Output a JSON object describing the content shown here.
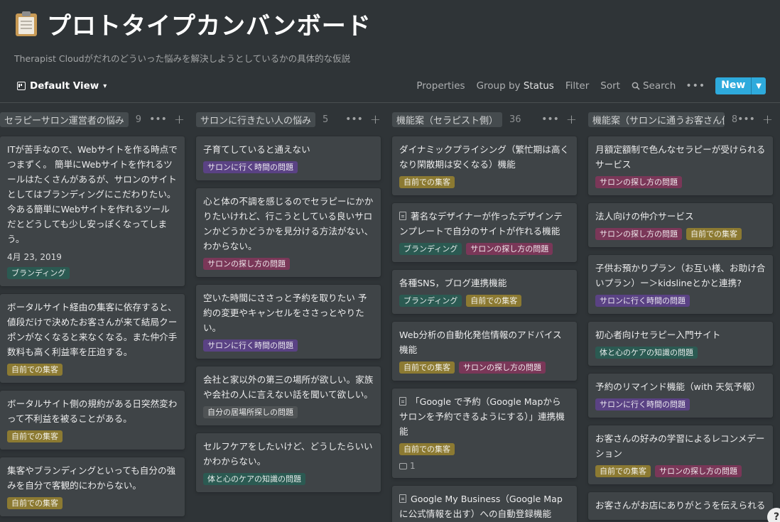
{
  "page": {
    "icon": "clipboard-icon",
    "title": "プロトタイプカンバンボード",
    "subtitle": "Therapist Cloudがだれのどういった悩みを解決しようとしているかの具体的な仮説"
  },
  "toolbar": {
    "view_label": "Default View",
    "properties": "Properties",
    "group_by_prefix": "Group by",
    "group_by_value": "Status",
    "filter": "Filter",
    "sort": "Sort",
    "search": "Search",
    "more": "•••",
    "new_label": "New"
  },
  "colors": {
    "accent": "#2eaadc",
    "tag_colors": {
      "green": "#2b5a52",
      "pink": "#7a3758",
      "yellow": "#8c7a32",
      "purple": "#5a4284",
      "gray": "#4f5355"
    }
  },
  "columns": [
    {
      "label": "セラピーサロン運営者の悩み",
      "count": "9",
      "cards": [
        {
          "title": "ITが苦手なので、Webサイトを作る時点でつまずく。 簡単にWebサイトを作れるツールはたくさんがあるが、サロンのサイトとしてはブランディングにこだわりたい。今ある簡単にWebサイトを作れるツールだとどうしても少し安っぽくなってしまう。",
          "date": "4月 23, 2019",
          "tags": [
            {
              "label": "ブランディング",
              "color": "green"
            }
          ]
        },
        {
          "title": "ボータルサイト経由の集客に依存すると、値段だけで決めたお客さんが来て結局クーポンがなくなると来なくなる。また仲介手数料も高く利益率を圧迫する。",
          "tags": [
            {
              "label": "自前での集客",
              "color": "yellow"
            }
          ]
        },
        {
          "title": "ボータルサイト側の規約がある日突然変わって不利益を被ることがある。",
          "tags": [
            {
              "label": "自前での集客",
              "color": "yellow"
            }
          ]
        },
        {
          "title": "集客やブランディングといっても自分の強みを自分で客観的にわからない。",
          "tags": [
            {
              "label": "自前での集客",
              "color": "yellow"
            }
          ]
        }
      ]
    },
    {
      "label": "サロンに行きたい人の悩み",
      "count": "5",
      "cards": [
        {
          "title": "子育てしていると通えない",
          "tags": [
            {
              "label": "サロンに行く時間の問題",
              "color": "purple"
            }
          ]
        },
        {
          "title": "心と体の不調を感じるのでセラピーにかかりたいけれど、行こうとしている良いサロンかどうかどうかを見分ける方法がない、わからない。",
          "tags": [
            {
              "label": "サロンの探し方の問題",
              "color": "pink"
            }
          ]
        },
        {
          "title": "空いた時間にささっと予約を取りたい 予約の変更やキャンセルをささっとやりたい。",
          "tags": [
            {
              "label": "サロンに行く時間の問題",
              "color": "purple"
            }
          ]
        },
        {
          "title": "会社と家以外の第三の場所が欲しい。家族や会社の人に言えない話を聞いて欲しい。",
          "tags": [
            {
              "label": "自分の居場所探しの問題",
              "color": "gray"
            }
          ]
        },
        {
          "title": "セルフケアをしたいけど、どうしたらいいかわからない。",
          "tags": [
            {
              "label": "体と心のケアの知識の問題",
              "color": "green"
            }
          ]
        }
      ]
    },
    {
      "label": "機能案（セラピスト側）",
      "count": "36",
      "cards": [
        {
          "title": "ダイナミックプライシング（繁忙期は高くなり閑散期は安くなる）機能",
          "tags": [
            {
              "label": "自前での集客",
              "color": "yellow"
            }
          ]
        },
        {
          "title": "著名なデザイナーが作ったデザインテンプレートで自分のサイトが作れる機能",
          "doc": true,
          "tags": [
            {
              "label": "ブランディング",
              "color": "green"
            },
            {
              "label": "サロンの探し方の問題",
              "color": "pink"
            }
          ]
        },
        {
          "title": "各種SNS，ブログ連携機能",
          "tags": [
            {
              "label": "ブランディング",
              "color": "green"
            },
            {
              "label": "自前での集客",
              "color": "yellow"
            }
          ]
        },
        {
          "title": "Web分析の自動化発信情報のアドバイス機能",
          "tags": [
            {
              "label": "自前での集客",
              "color": "yellow"
            },
            {
              "label": "サロンの探し方の問題",
              "color": "pink"
            }
          ]
        },
        {
          "title": "「Google で予約（Google Mapからサロンを予約できるようにする）」連携機能",
          "doc": true,
          "tags": [
            {
              "label": "自前での集客",
              "color": "yellow"
            }
          ],
          "comments": "1"
        },
        {
          "title": "Google My Business（Google Mapに公式情報を出す）への自動登録機能",
          "doc": true,
          "tags": []
        }
      ]
    },
    {
      "label": "機能案（サロンに通うお客さん側）",
      "count": "8",
      "cards": [
        {
          "title": "月額定額制で色んなセラピーが受けられるサービス",
          "tags": [
            {
              "label": "サロンの探し方の問題",
              "color": "pink"
            }
          ]
        },
        {
          "title": "法人向けの仲介サービス",
          "tags": [
            {
              "label": "サロンの探し方の問題",
              "color": "pink"
            },
            {
              "label": "自前での集客",
              "color": "yellow"
            }
          ]
        },
        {
          "title": "子供お預かりプラン（お互い様、お助け合いプラン）ー＞kidslineとかと連携?",
          "tags": [
            {
              "label": "サロンに行く時間の問題",
              "color": "purple"
            }
          ]
        },
        {
          "title": "初心者向けセラピー入門サイト",
          "tags": [
            {
              "label": "体と心のケアの知識の問題",
              "color": "green"
            }
          ]
        },
        {
          "title": "予約のリマインド機能（with 天気予報）",
          "tags": [
            {
              "label": "サロンに行く時間の問題",
              "color": "purple"
            }
          ]
        },
        {
          "title": "お客さんの好みの学習によるレコンメデーション",
          "tags": [
            {
              "label": "自前での集客",
              "color": "yellow"
            },
            {
              "label": "サロンの探し方の問題",
              "color": "pink"
            }
          ]
        },
        {
          "title": "お客さんがお店にありがとうを伝えられる",
          "tags": []
        }
      ]
    }
  ],
  "help": "?"
}
